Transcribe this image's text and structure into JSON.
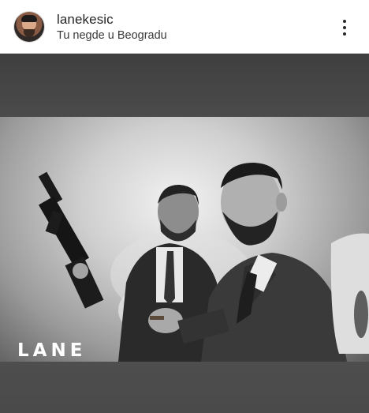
{
  "post": {
    "username": "lanekesic",
    "location": "Tu negde u Beogradu",
    "more_icon": "vertical-ellipsis-icon",
    "avatar_icon": "profile-avatar"
  },
  "photo": {
    "brand_text": "LANE"
  }
}
